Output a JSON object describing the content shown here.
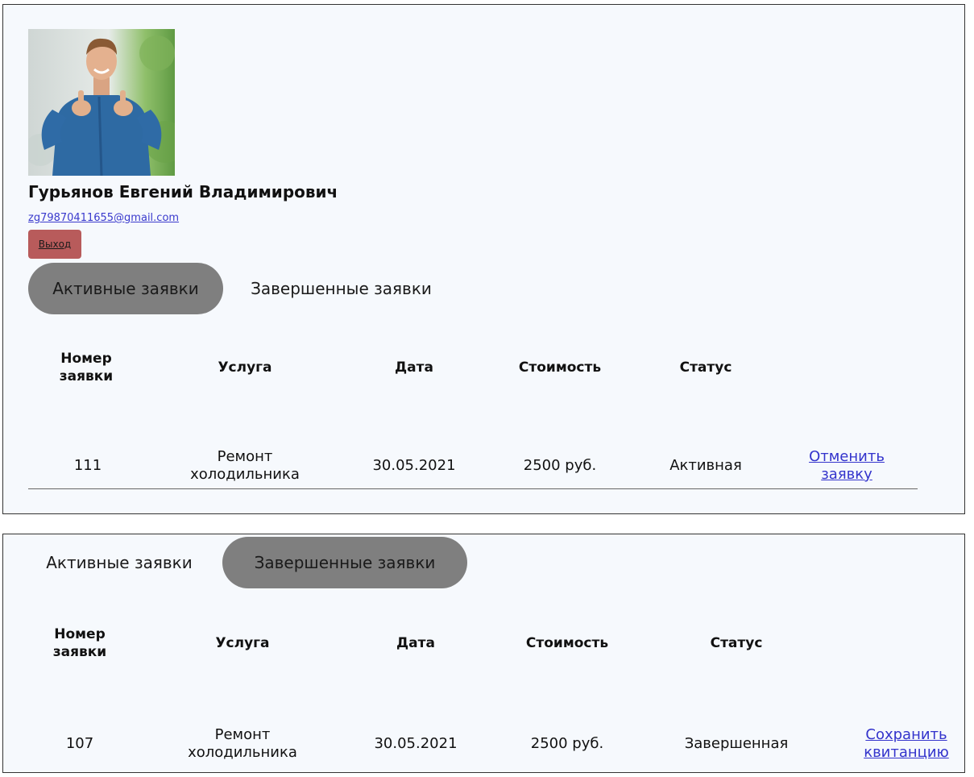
{
  "profile": {
    "name": "Гурьянов Евгений Владимирович",
    "email": "zg79870411655@gmail.com",
    "logout_label": "Выход"
  },
  "tabs": {
    "active_label": "Активные заявки",
    "completed_label": "Завершенные заявки"
  },
  "table_headers": {
    "number": "Номер заявки",
    "service": "Услуга",
    "date": "Дата",
    "cost": "Стоимость",
    "status": "Статус"
  },
  "active_orders": [
    {
      "number": "111",
      "service": "Ремонт холодильника",
      "date": "30.05.2021",
      "cost": "2500 руб.",
      "status": "Активная",
      "action": "Отменить заявку"
    }
  ],
  "completed_orders": [
    {
      "number": "107",
      "service": "Ремонт холодильника",
      "date": "30.05.2021",
      "cost": "2500 руб.",
      "status": "Завершенная",
      "action": "Сохранить квитанцию"
    }
  ],
  "colors": {
    "panel_bg": "#f6f9fd",
    "selected_tab": "#7f7f7f",
    "logout_btn": "#b85b5b",
    "link": "#3333cc"
  },
  "icons": {
    "avatar": "user-photo"
  }
}
